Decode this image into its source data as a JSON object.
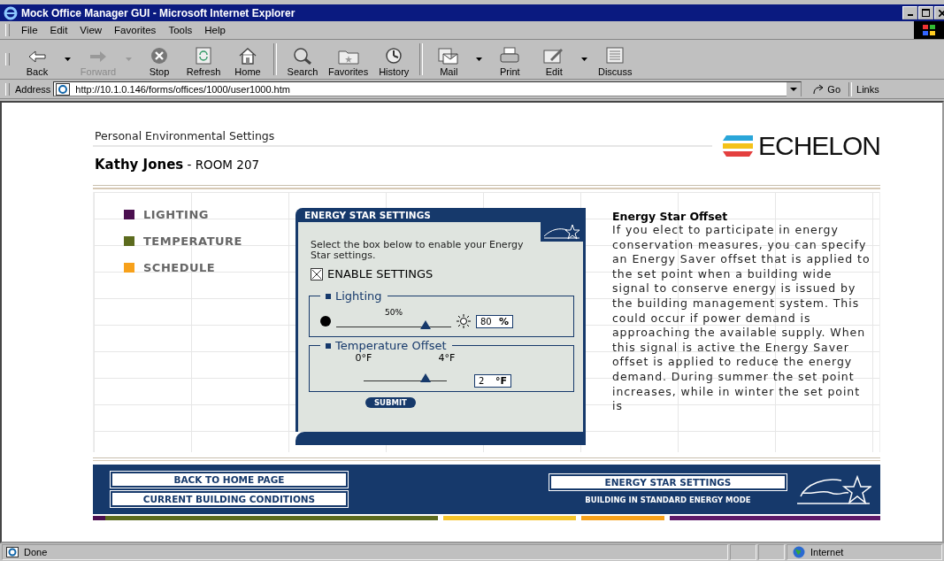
{
  "window": {
    "title": "Mock Office Manager GUI - Microsoft Internet Explorer"
  },
  "menu": [
    {
      "label": "File"
    },
    {
      "label": "Edit"
    },
    {
      "label": "View"
    },
    {
      "label": "Favorites"
    },
    {
      "label": "Tools"
    },
    {
      "label": "Help"
    }
  ],
  "toolbar": [
    {
      "label": "Back",
      "kind": "back",
      "disabled": false,
      "dropdown": true
    },
    {
      "label": "Forward",
      "kind": "forward",
      "disabled": true,
      "dropdown": true
    },
    {
      "label": "Stop",
      "kind": "stop",
      "disabled": false,
      "dropdown": false
    },
    {
      "label": "Refresh",
      "kind": "refresh",
      "disabled": false,
      "dropdown": false
    },
    {
      "label": "Home",
      "kind": "home",
      "disabled": false,
      "dropdown": false
    },
    {
      "label": "Search",
      "kind": "search",
      "disabled": false,
      "dropdown": false
    },
    {
      "label": "Favorites",
      "kind": "favorites",
      "disabled": false,
      "dropdown": false
    },
    {
      "label": "History",
      "kind": "history",
      "disabled": false,
      "dropdown": false
    },
    {
      "label": "Mail",
      "kind": "mail",
      "disabled": false,
      "dropdown": true
    },
    {
      "label": "Print",
      "kind": "print",
      "disabled": false,
      "dropdown": false
    },
    {
      "label": "Edit",
      "kind": "edit",
      "disabled": false,
      "dropdown": true
    },
    {
      "label": "Discuss",
      "kind": "discuss",
      "disabled": false,
      "dropdown": false
    }
  ],
  "address": {
    "label": "Address",
    "url": "http://10.1.0.146/forms/offices/1000/user1000.htm",
    "go": "Go",
    "links": "Links"
  },
  "page": {
    "subtitle": "Personal Environmental Settings",
    "user": "**Kathy Jones** - ROOM 207",
    "logo": "ECHELON",
    "nav": [
      {
        "label": "LIGHTING",
        "color": "#4b0f4f"
      },
      {
        "label": "TEMPERATURE",
        "color": "#5c6b1e"
      },
      {
        "label": "SCHEDULE",
        "color": "#f7a11b"
      }
    ],
    "panel": {
      "title": "ENERGY STAR SETTINGS",
      "instruction": "Select the box below to enable your Energy Star settings.",
      "enable": {
        "label": "ENABLE SETTINGS",
        "checked": true
      },
      "lighting": {
        "title": "Lighting",
        "tick": "50%",
        "level": 0.78,
        "value": "80",
        "unit": "%"
      },
      "temperature": {
        "title": "Temperature Offset",
        "min": "0°F",
        "max": "4°F",
        "level": 0.74,
        "value": "2",
        "unit": "°F"
      },
      "submit": "SUBMIT"
    },
    "info": {
      "title": "Energy Star Offset",
      "body": "If you elect to participate in energy conservation measures, you can specify an Energy Saver offset that is applied to the set point when a building wide signal to conserve energy is issued by the building management system. This could occur if power demand is approaching the available supply. When this signal is active the Energy Saver offset is applied to reduce the energy demand. During summer the set point increases, while in winter the set point is"
    },
    "footer": {
      "home": "BACK TO HOME PAGE",
      "conditions": "CURRENT BUILDING CONDITIONS",
      "settings": "ENERGY STAR SETTINGS",
      "mode": "BUILDING IN STANDARD ENERGY MODE"
    }
  },
  "status_bar": {
    "text": "Done",
    "zone": "Internet"
  }
}
